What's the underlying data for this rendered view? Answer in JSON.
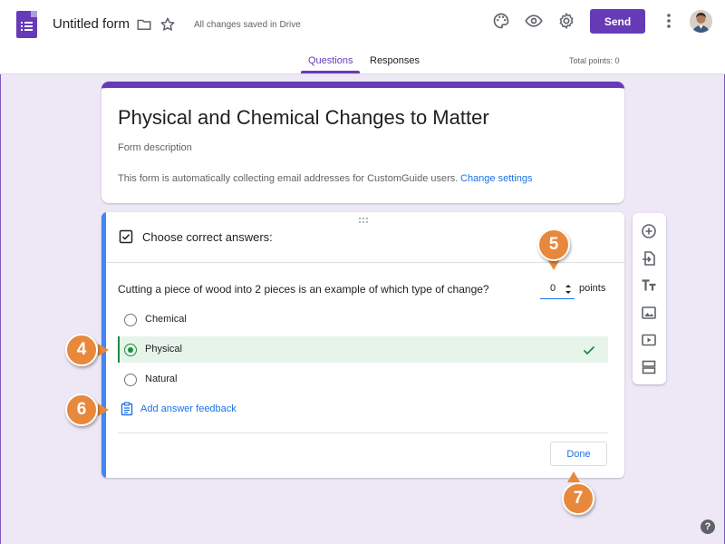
{
  "header": {
    "form_title": "Untitled form",
    "saved_status": "All changes saved in Drive",
    "send_label": "Send",
    "tabs": [
      {
        "label": "Questions",
        "active": true
      },
      {
        "label": "Responses",
        "active": false
      }
    ],
    "total_points": "Total points: 0",
    "icons": [
      "forms-app-icon",
      "folder-icon",
      "star-icon",
      "palette-icon",
      "preview-eye-icon",
      "settings-gear-icon",
      "more-vert-icon",
      "avatar"
    ]
  },
  "form": {
    "title": "Physical and Chemical Changes to Matter",
    "description_placeholder": "Form description",
    "email_note": "This form is automatically collecting email addresses for CustomGuide users.",
    "change_settings": "Change settings"
  },
  "question": {
    "mode_label": "Choose correct answers:",
    "text": "Cutting a piece of wood into 2 pieces is an example of which type of change?",
    "points_value": "0",
    "points_label": "points",
    "options": [
      {
        "label": "Chemical",
        "selected": false
      },
      {
        "label": "Physical",
        "selected": true,
        "correct": true
      },
      {
        "label": "Natural",
        "selected": false
      }
    ],
    "feedback_link": "Add answer feedback",
    "done_label": "Done"
  },
  "toolbar": {
    "items": [
      "add-question-icon",
      "import-questions-icon",
      "add-title-icon",
      "add-image-icon",
      "add-video-icon",
      "add-section-icon"
    ]
  },
  "callouts": [
    "4",
    "5",
    "6",
    "7"
  ],
  "help": "?",
  "colors": {
    "accent": "#673ab7",
    "background": "#ede7f6",
    "link": "#1a73e8",
    "correct": "#1e8e3e",
    "callout": "#e8883c",
    "question_accent": "#4285f4"
  }
}
